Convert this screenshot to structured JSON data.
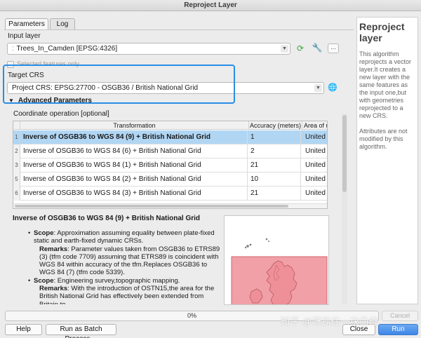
{
  "window": {
    "title": "Reproject Layer"
  },
  "tabs": [
    {
      "label": "Parameters",
      "active": true
    },
    {
      "label": "Log",
      "active": false
    }
  ],
  "input_layer": {
    "label": "Input layer",
    "value": "Trees_In_Camden [EPSG:4326]",
    "selected_only_label": "Selected features only",
    "selected_only_checked": false
  },
  "target_crs": {
    "label": "Target CRS",
    "value": "Project CRS: EPSG:27700 - OSGB36 / British National Grid"
  },
  "advanced": {
    "label": "Advanced Parameters",
    "expanded": true
  },
  "coordinate_operation": {
    "label": "Coordinate operation [optional]",
    "columns": [
      "Transformation",
      "Accuracy (meters)",
      "Area of use"
    ],
    "rows": [
      {
        "index": "1",
        "transformation": "Inverse of OSGB36 to WGS 84 (9) + British National Grid",
        "accuracy": "1",
        "area": "United Kingdom",
        "selected": true
      },
      {
        "index": "2",
        "transformation": "Inverse of OSGB36 to WGS 84 (6) + British National Grid",
        "accuracy": "2",
        "area": "United Kingdom",
        "selected": false
      },
      {
        "index": "3",
        "transformation": "Inverse of OSGB36 to WGS 84 (1) + British National Grid",
        "accuracy": "21",
        "area": "United Kingdom",
        "selected": false
      },
      {
        "index": "5",
        "transformation": "Inverse of OSGB36 to WGS 84 (2) + British National Grid",
        "accuracy": "10",
        "area": "United Kingdom",
        "selected": false
      },
      {
        "index": "6",
        "transformation": "Inverse of OSGB36 to WGS 84 (3) + British National Grid",
        "accuracy": "21",
        "area": "United Kingdom",
        "selected": false
      }
    ]
  },
  "detail": {
    "title": "Inverse of OSGB36 to WGS 84 (9) + British National Grid",
    "scope1_label": "Scope",
    "scope1_text": ": Approximation assuming equality between plate-fixed static and earth-fixed dynamic CRSs.",
    "remarks1_label": "Remarks",
    "remarks1_text": ": Parameter values taken from OSGB36 to ETRS89 (3) (tfm code 7709) assuming that ETRS89 is coincident with WGS 84 within accuracy of the tfm.Replaces OSGB36 to WGS 84 (7) (tfm code 5339).",
    "scope2_label": "Scope",
    "scope2_text": ": Engineering survey,topographic mapping.",
    "remarks2_label": "Remarks",
    "remarks2_text": ": With the introduction of OSTN15,the area for the British National Grid has effectively been extended from Britain to"
  },
  "help": {
    "title": "Reproject layer",
    "para1": "This algorithm reprojects a vector layer.It creates a new layer with the same features as the input one,but with geometries reprojected to a new CRS.",
    "para2": "Attributes are not modified by this algorithm."
  },
  "progress": {
    "text": "0%",
    "value": 0
  },
  "buttons": {
    "cancel": "Cancel",
    "help": "Help",
    "batch": "Run as Batch Process…",
    "close": "Close",
    "run": "Run"
  },
  "watermark": "知乎 @呀抓住一块曲奇",
  "colors": {
    "highlight": "#2b8de6",
    "selected_row": "#b1d6f4",
    "run_button": "#3e86e6",
    "area_fill": "#f0a0a6"
  },
  "icons": [
    "point-layer-icon",
    "iterate-icon",
    "wrench-icon",
    "more-icon",
    "crs-select-icon",
    "chevron-down-icon"
  ]
}
